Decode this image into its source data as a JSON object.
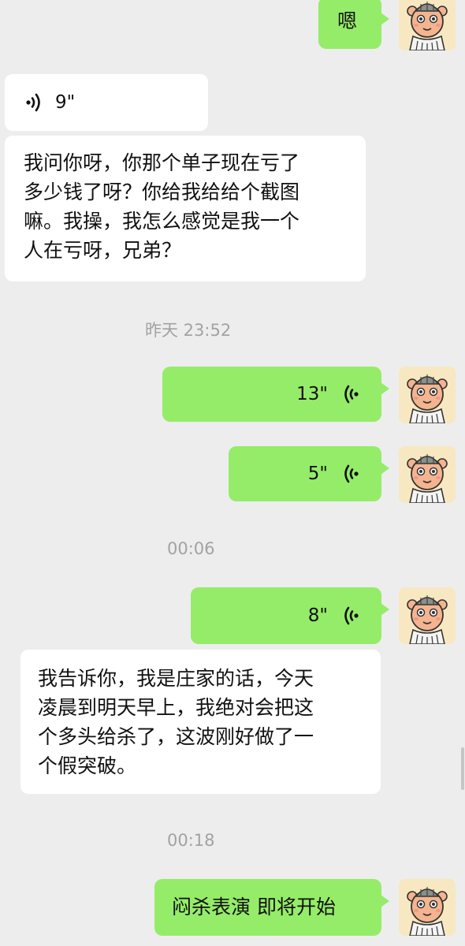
{
  "messages": [
    {
      "id": "m1",
      "side": "right",
      "kind": "text",
      "text": "嗯"
    },
    {
      "id": "m2",
      "side": "left",
      "kind": "voice",
      "duration": "9\""
    },
    {
      "id": "m3",
      "side": "left",
      "kind": "text",
      "lines": [
        "我问你呀，你那个单子现在亏了",
        "多少钱了呀？你给我给给个截图",
        "嘛。我操，我怎么感觉是我一个",
        "人在亏呀，兄弟？"
      ]
    },
    {
      "id": "t1",
      "kind": "time",
      "text": "昨天 23:52"
    },
    {
      "id": "m4",
      "side": "right",
      "kind": "voice",
      "duration": "13\""
    },
    {
      "id": "m5",
      "side": "right",
      "kind": "voice",
      "duration": "5\""
    },
    {
      "id": "t2",
      "kind": "time",
      "text": "00:06"
    },
    {
      "id": "m6",
      "side": "right",
      "kind": "voice",
      "duration": "8\""
    },
    {
      "id": "m7",
      "side": "left",
      "kind": "text",
      "lines": [
        "我告诉你，我是庄家的话，今天",
        "凌晨到明天早上，我绝对会把这",
        "个多头给杀了，这波刚好做了一",
        "个假突破。"
      ]
    },
    {
      "id": "t3",
      "kind": "time",
      "text": "00:18"
    },
    {
      "id": "m8",
      "side": "right",
      "kind": "text",
      "text": "闷杀表演 即将开始"
    }
  ],
  "colors": {
    "background": "#ededed",
    "bubble_self": "#95ec69",
    "bubble_other": "#ffffff",
    "timestamp": "#a2a2a2",
    "avatar_bg": "#f7e8c2",
    "avatar_face": "#f4b48f"
  },
  "icons": {
    "voice": "voice-wave-icon",
    "avatar": "cartoon-pig-avatar"
  }
}
